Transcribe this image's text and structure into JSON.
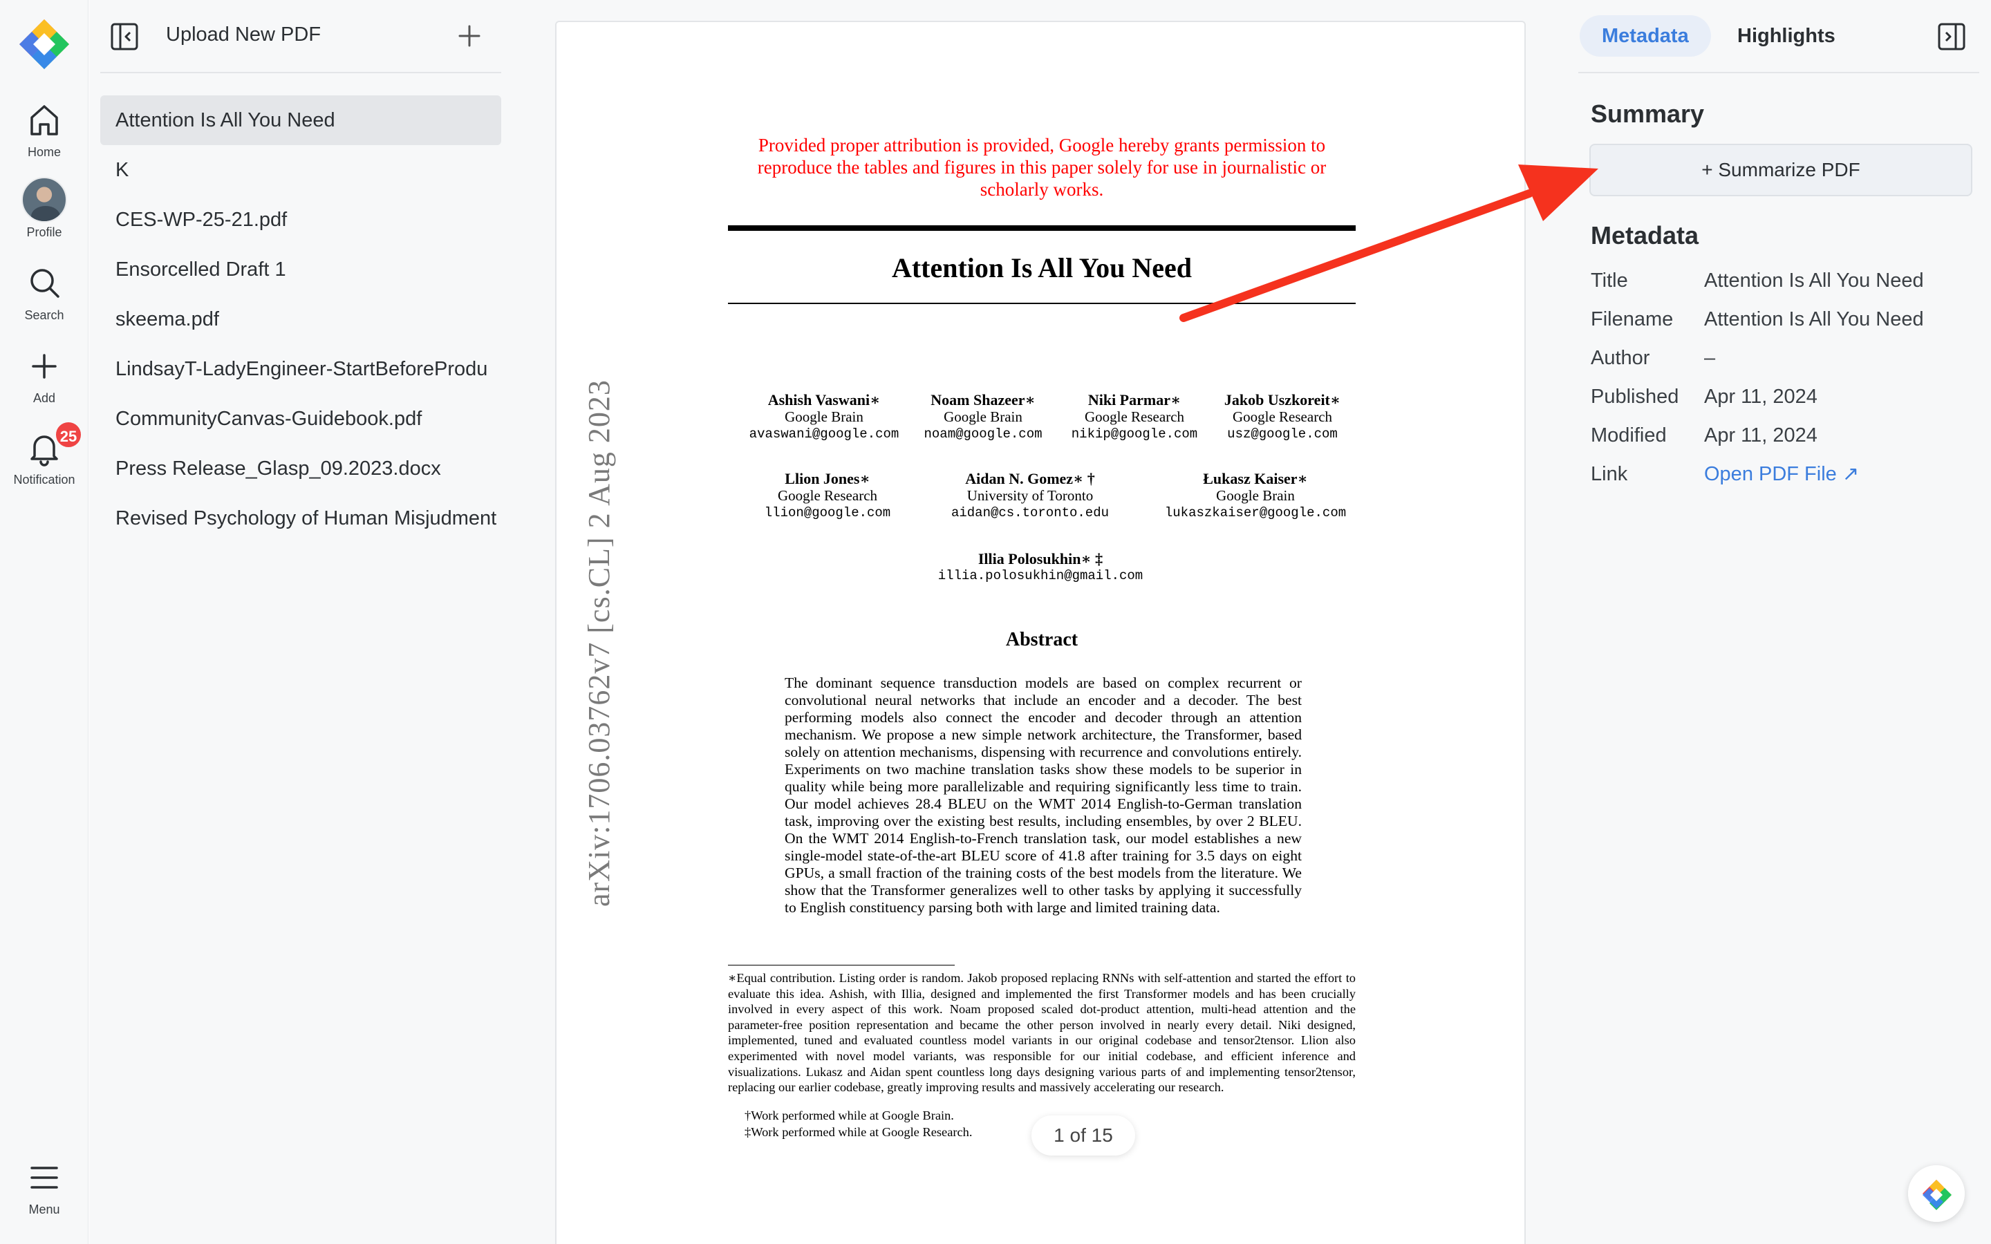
{
  "rail": {
    "items": [
      {
        "label": "Home",
        "icon": "home-icon"
      },
      {
        "label": "Profile",
        "icon": "avatar"
      },
      {
        "label": "Search",
        "icon": "search-icon"
      },
      {
        "label": "Add",
        "icon": "plus-icon"
      },
      {
        "label": "Notification",
        "icon": "bell-icon",
        "badge": "25"
      },
      {
        "label": "Menu",
        "icon": "menu-icon"
      }
    ]
  },
  "files": {
    "upload_label": "Upload New PDF",
    "items": [
      {
        "name": "Attention Is All You Need",
        "active": true
      },
      {
        "name": "K"
      },
      {
        "name": "CES-WP-25-21.pdf"
      },
      {
        "name": "Ensorcelled Draft 1"
      },
      {
        "name": "skeema.pdf"
      },
      {
        "name": "LindsayT-LadyEngineer-StartBeforeProdu"
      },
      {
        "name": "CommunityCanvas-Guidebook.pdf"
      },
      {
        "name": "Press Release_Glasp_09.2023.docx"
      },
      {
        "name": "Revised Psychology of Human Misjudment"
      }
    ]
  },
  "paper": {
    "notice": "Provided proper attribution is provided, Google hereby grants permission to reproduce the tables and figures in this paper solely for use in journalistic or scholarly works.",
    "title": "Attention Is All You Need",
    "arxiv": "arXiv:1706.03762v7  [cs.CL]  2 Aug 2023",
    "authors": [
      {
        "name": "Ashish Vaswani∗",
        "org": "Google Brain",
        "email": "avaswani@google.com"
      },
      {
        "name": "Noam Shazeer∗",
        "org": "Google Brain",
        "email": "noam@google.com"
      },
      {
        "name": "Niki Parmar∗",
        "org": "Google Research",
        "email": "nikip@google.com"
      },
      {
        "name": "Jakob Uszkoreit∗",
        "org": "Google Research",
        "email": "usz@google.com"
      },
      {
        "name": "Llion Jones∗",
        "org": "Google Research",
        "email": "llion@google.com"
      },
      {
        "name": "Aidan N. Gomez∗ †",
        "org": "University of Toronto",
        "email": "aidan@cs.toronto.edu"
      },
      {
        "name": "Łukasz Kaiser∗",
        "org": "Google Brain",
        "email": "lukaszkaiser@google.com"
      },
      {
        "name": "Illia Polosukhin∗ ‡",
        "org": "",
        "email": "illia.polosukhin@gmail.com"
      }
    ],
    "abstract_heading": "Abstract",
    "abstract": "The dominant sequence transduction models are based on complex recurrent or convolutional neural networks that include an encoder and a decoder. The best performing models also connect the encoder and decoder through an attention mechanism. We propose a new simple network architecture, the Transformer, based solely on attention mechanisms, dispensing with recurrence and convolutions entirely. Experiments on two machine translation tasks show these models to be superior in quality while being more parallelizable and requiring significantly less time to train. Our model achieves 28.4 BLEU on the WMT 2014 English-to-German translation task, improving over the existing best results, including ensembles, by over 2 BLEU. On the WMT 2014 English-to-French translation task, our model establishes a new single-model state-of-the-art BLEU score of 41.8 after training for 3.5 days on eight GPUs, a small fraction of the training costs of the best models from the literature. We show that the Transformer generalizes well to other tasks by applying it successfully to English constituency parsing both with large and limited training data.",
    "footnote": "∗Equal contribution. Listing order is random. Jakob proposed replacing RNNs with self-attention and started the effort to evaluate this idea. Ashish, with Illia, designed and implemented the first Transformer models and has been crucially involved in every aspect of this work. Noam proposed scaled dot-product attention, multi-head attention and the parameter-free position representation and became the other person involved in nearly every detail. Niki designed, implemented, tuned and evaluated countless model variants in our original codebase and tensor2tensor. Llion also experimented with novel model variants, was responsible for our initial codebase, and efficient inference and visualizations. Lukasz and Aidan spent countless long days designing various parts of and implementing tensor2tensor, replacing our earlier codebase, greatly improving results and massively accelerating our research.",
    "footnote_brain": "†Work performed while at Google Brain.",
    "footnote_research": "‡Work performed while at Google Research.",
    "pager": "1 of 15"
  },
  "side": {
    "tabs": [
      {
        "label": "Metadata",
        "active": true
      },
      {
        "label": "Highlights"
      }
    ],
    "summary_heading": "Summary",
    "summarize_button": "+ Summarize PDF",
    "metadata_heading": "Metadata",
    "rows": [
      {
        "key": "Title",
        "value": "Attention Is All You Need"
      },
      {
        "key": "Filename",
        "value": "Attention Is All You Need"
      },
      {
        "key": "Author",
        "value": "–"
      },
      {
        "key": "Published",
        "value": "Apr 11, 2024"
      },
      {
        "key": "Modified",
        "value": "Apr 11, 2024"
      },
      {
        "key": "Link",
        "value": "Open PDF File ↗"
      }
    ]
  },
  "colors": {
    "accent": "#3b7ddd",
    "badge": "#ef4444",
    "annotation_arrow": "#f5321e",
    "notice": "#ff0000"
  }
}
